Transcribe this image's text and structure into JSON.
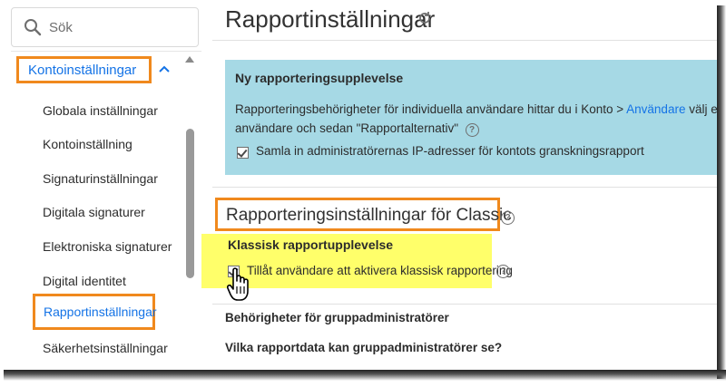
{
  "sidebar": {
    "search_placeholder": "Sök",
    "group_label": "Kontoinställningar",
    "items": [
      {
        "label": "Globala inställningar"
      },
      {
        "label": "Kontoinställning"
      },
      {
        "label": "Signaturinställningar"
      },
      {
        "label": "Digitala signaturer"
      },
      {
        "label": "Elektroniska signaturer"
      },
      {
        "label": "Digital identitet"
      },
      {
        "label": "Rapportinställningar",
        "active": true
      },
      {
        "label": "Säkerhetsinställningar"
      }
    ]
  },
  "main": {
    "title": "Rapportinställningar",
    "info": {
      "title": "Ny rapporteringsupplevelse",
      "line1_pre": "Rapporteringsbehörigheter för individuella användare hittar du i Konto > ",
      "line1_link": "Användare",
      "line1_post": " välj en",
      "line2": "användare och sedan \"Rapportalternativ\"",
      "checkbox_label": "Samla in administratörernas IP-adresser för kontots granskningsrapport",
      "checkbox_checked": true
    },
    "classic": {
      "heading": "Rapporteringsinställningar för Classic",
      "subheading": "Klassisk rapportupplevelse",
      "checkbox_label": "Tillåt användare att aktivera klassisk rapportering",
      "checkbox_checked": true
    },
    "group_admin_heading": "Behörigheter för gruppadministratörer",
    "group_admin_question": "Vilka rapportdata kan gruppadministratörer se?"
  },
  "colors": {
    "accent_blue": "#1473e6",
    "callout_orange": "#f0891d",
    "info_bg": "#a6d9e5",
    "highlight_yellow": "#ffff6a"
  },
  "help_glyph": "?"
}
